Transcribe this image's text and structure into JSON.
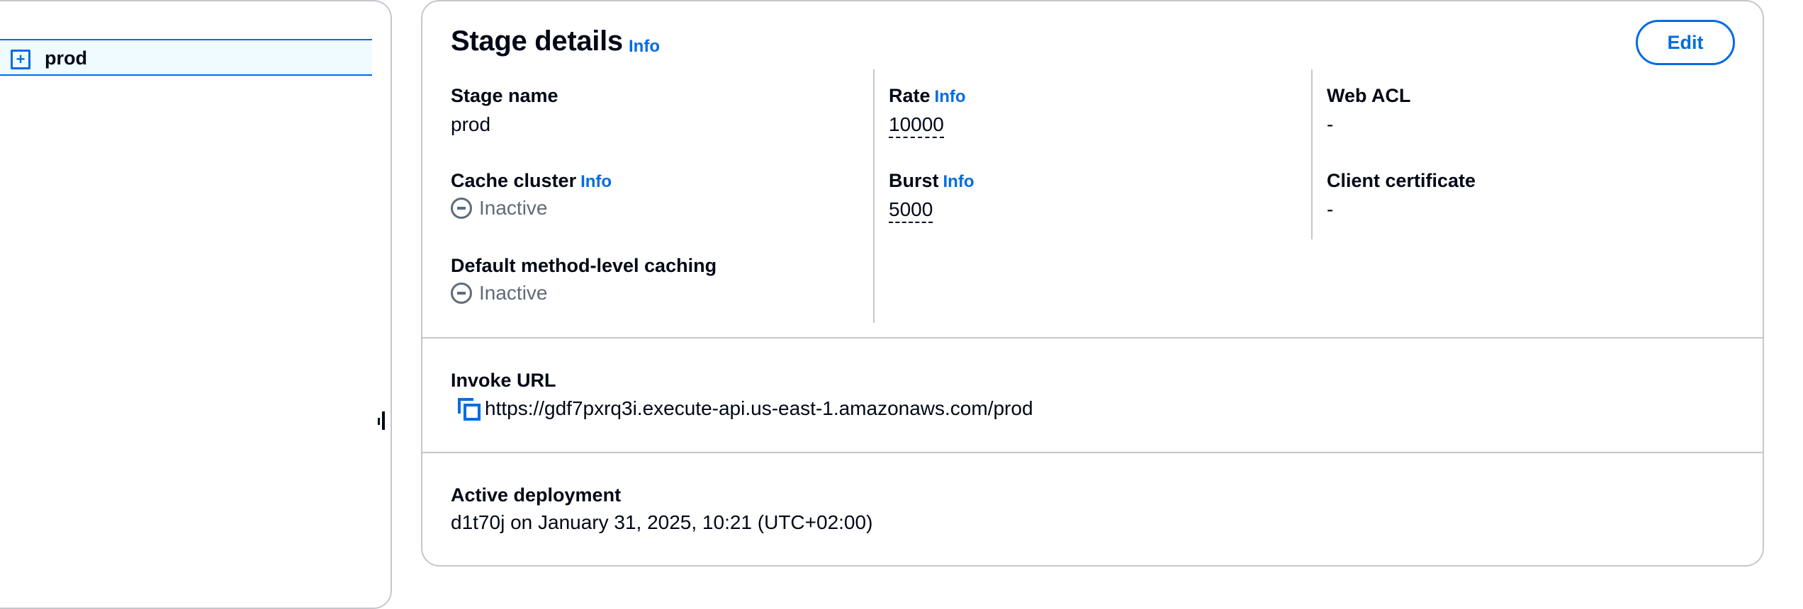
{
  "sidebar": {
    "tree_item": {
      "toggle_symbol": "+",
      "label": "prod"
    }
  },
  "stage": {
    "title": "Stage details",
    "title_info": "Info",
    "edit_label": "Edit",
    "stage_name_label": "Stage name",
    "stage_name_value": "prod",
    "cache_cluster_label": "Cache cluster",
    "cache_cluster_info": "Info",
    "cache_cluster_value": "Inactive",
    "default_caching_label": "Default method-level caching",
    "default_caching_value": "Inactive",
    "rate_label": "Rate",
    "rate_info": "Info",
    "rate_value": "10000",
    "burst_label": "Burst",
    "burst_info": "Info",
    "burst_value": "5000",
    "web_acl_label": "Web ACL",
    "web_acl_value": "-",
    "client_cert_label": "Client certificate",
    "client_cert_value": "-",
    "invoke_url_label": "Invoke URL",
    "invoke_url_value": "https://gdf7pxrq3i.execute-api.us-east-1.amazonaws.com/prod",
    "active_deployment_label": "Active deployment",
    "active_deployment_value": "d1t70j on January 31, 2025, 10:21 (UTC+02:00)"
  },
  "icons": {
    "expand": "plus-square-icon",
    "status_inactive": "minus-circle-icon",
    "copy": "copy-icon",
    "resize": "resize-handle-icon"
  },
  "colors": {
    "link": "#006ce0",
    "text": "#000716",
    "muted": "#5f6b7a",
    "border": "#c6c6cd",
    "selected_bg": "#f0fbff"
  }
}
